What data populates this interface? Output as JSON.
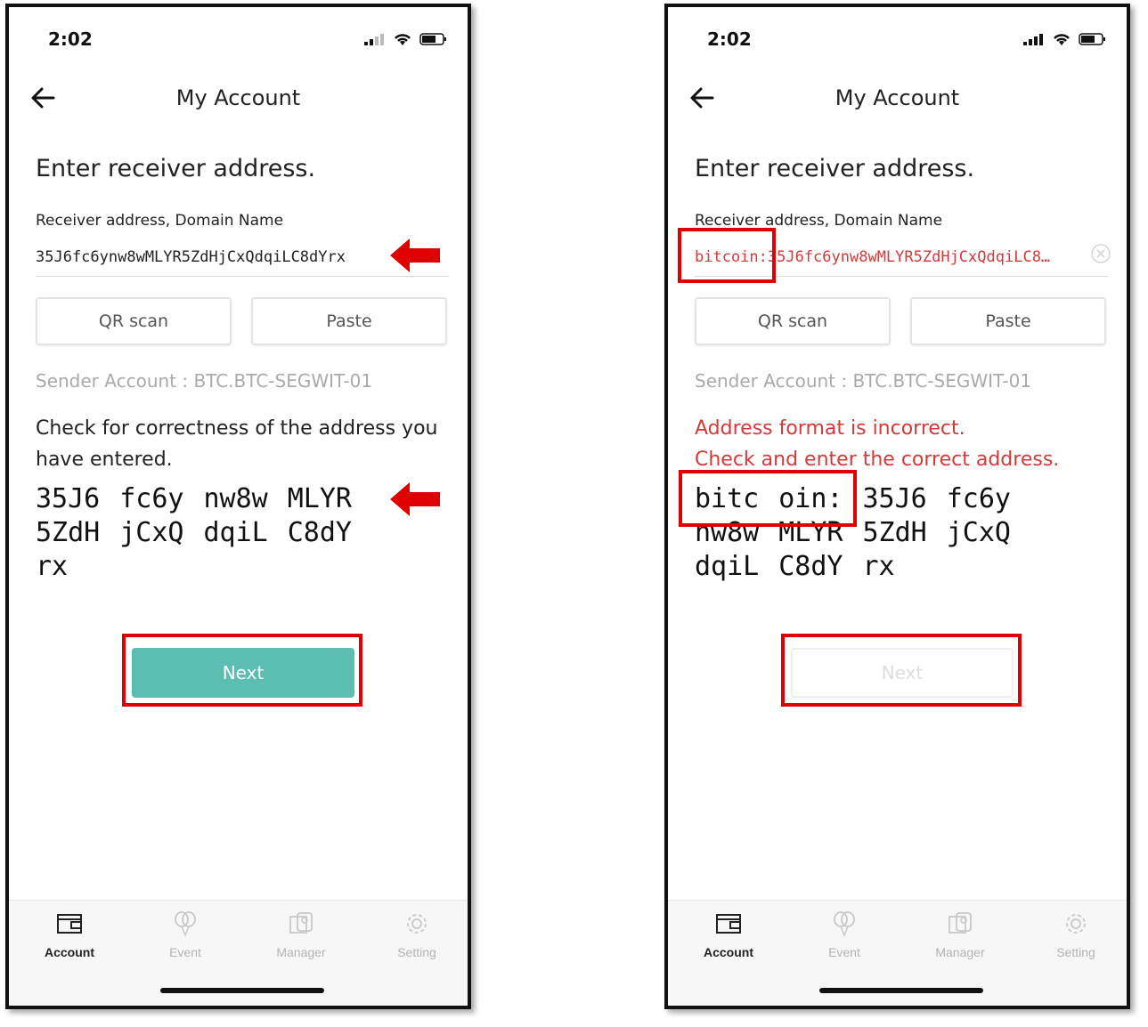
{
  "left": {
    "status_time": "2:02",
    "title": "My Account",
    "heading": "Enter receiver address.",
    "field_label": "Receiver address, Domain Name",
    "field_value": "35J6fc6ynw8wMLYR5ZdHjCxQdqiLC8dYrx",
    "qr_label": "QR scan",
    "paste_label": "Paste",
    "sender": "Sender Account : BTC.BTC-SEGWIT-01",
    "message_line1": "Check for correctness of the address you",
    "message_line2": "have entered.",
    "chunks": [
      "35J6",
      "fc6y",
      "nw8w",
      "MLYR",
      "5ZdH",
      "jCxQ",
      "dqiL",
      "C8dY",
      "rx"
    ],
    "next_label": "Next",
    "next_state": "enabled"
  },
  "right": {
    "status_time": "2:02",
    "title": "My Account",
    "heading": "Enter receiver address.",
    "field_label": "Receiver address, Domain Name",
    "field_value": "bitcoin:35J6fc6ynw8wMLYR5ZdHjCxQdqiLC8…",
    "qr_label": "QR scan",
    "paste_label": "Paste",
    "sender": "Sender Account : BTC.BTC-SEGWIT-01",
    "message_line1": "Address format is incorrect.",
    "message_line2": "Check and enter the correct address.",
    "chunks": [
      "bitc",
      "oin:",
      "35J6",
      "fc6y",
      "nw8w",
      "MLYR",
      "5ZdH",
      "jCxQ",
      "dqiL",
      "C8dY",
      "rx"
    ],
    "next_label": "Next",
    "next_state": "disabled"
  },
  "tabs": [
    "Account",
    "Event",
    "Manager",
    "Setting"
  ],
  "colors": {
    "accent": "#5cbdb2",
    "error": "#d33a3a",
    "highlight": "#e00000"
  },
  "icons": {
    "back": "arrow-left-icon",
    "clear": "clear-circle-icon",
    "account": "wallet-icon",
    "event": "balloons-icon",
    "manager": "id-badge-icon",
    "setting": "gear-icon"
  }
}
